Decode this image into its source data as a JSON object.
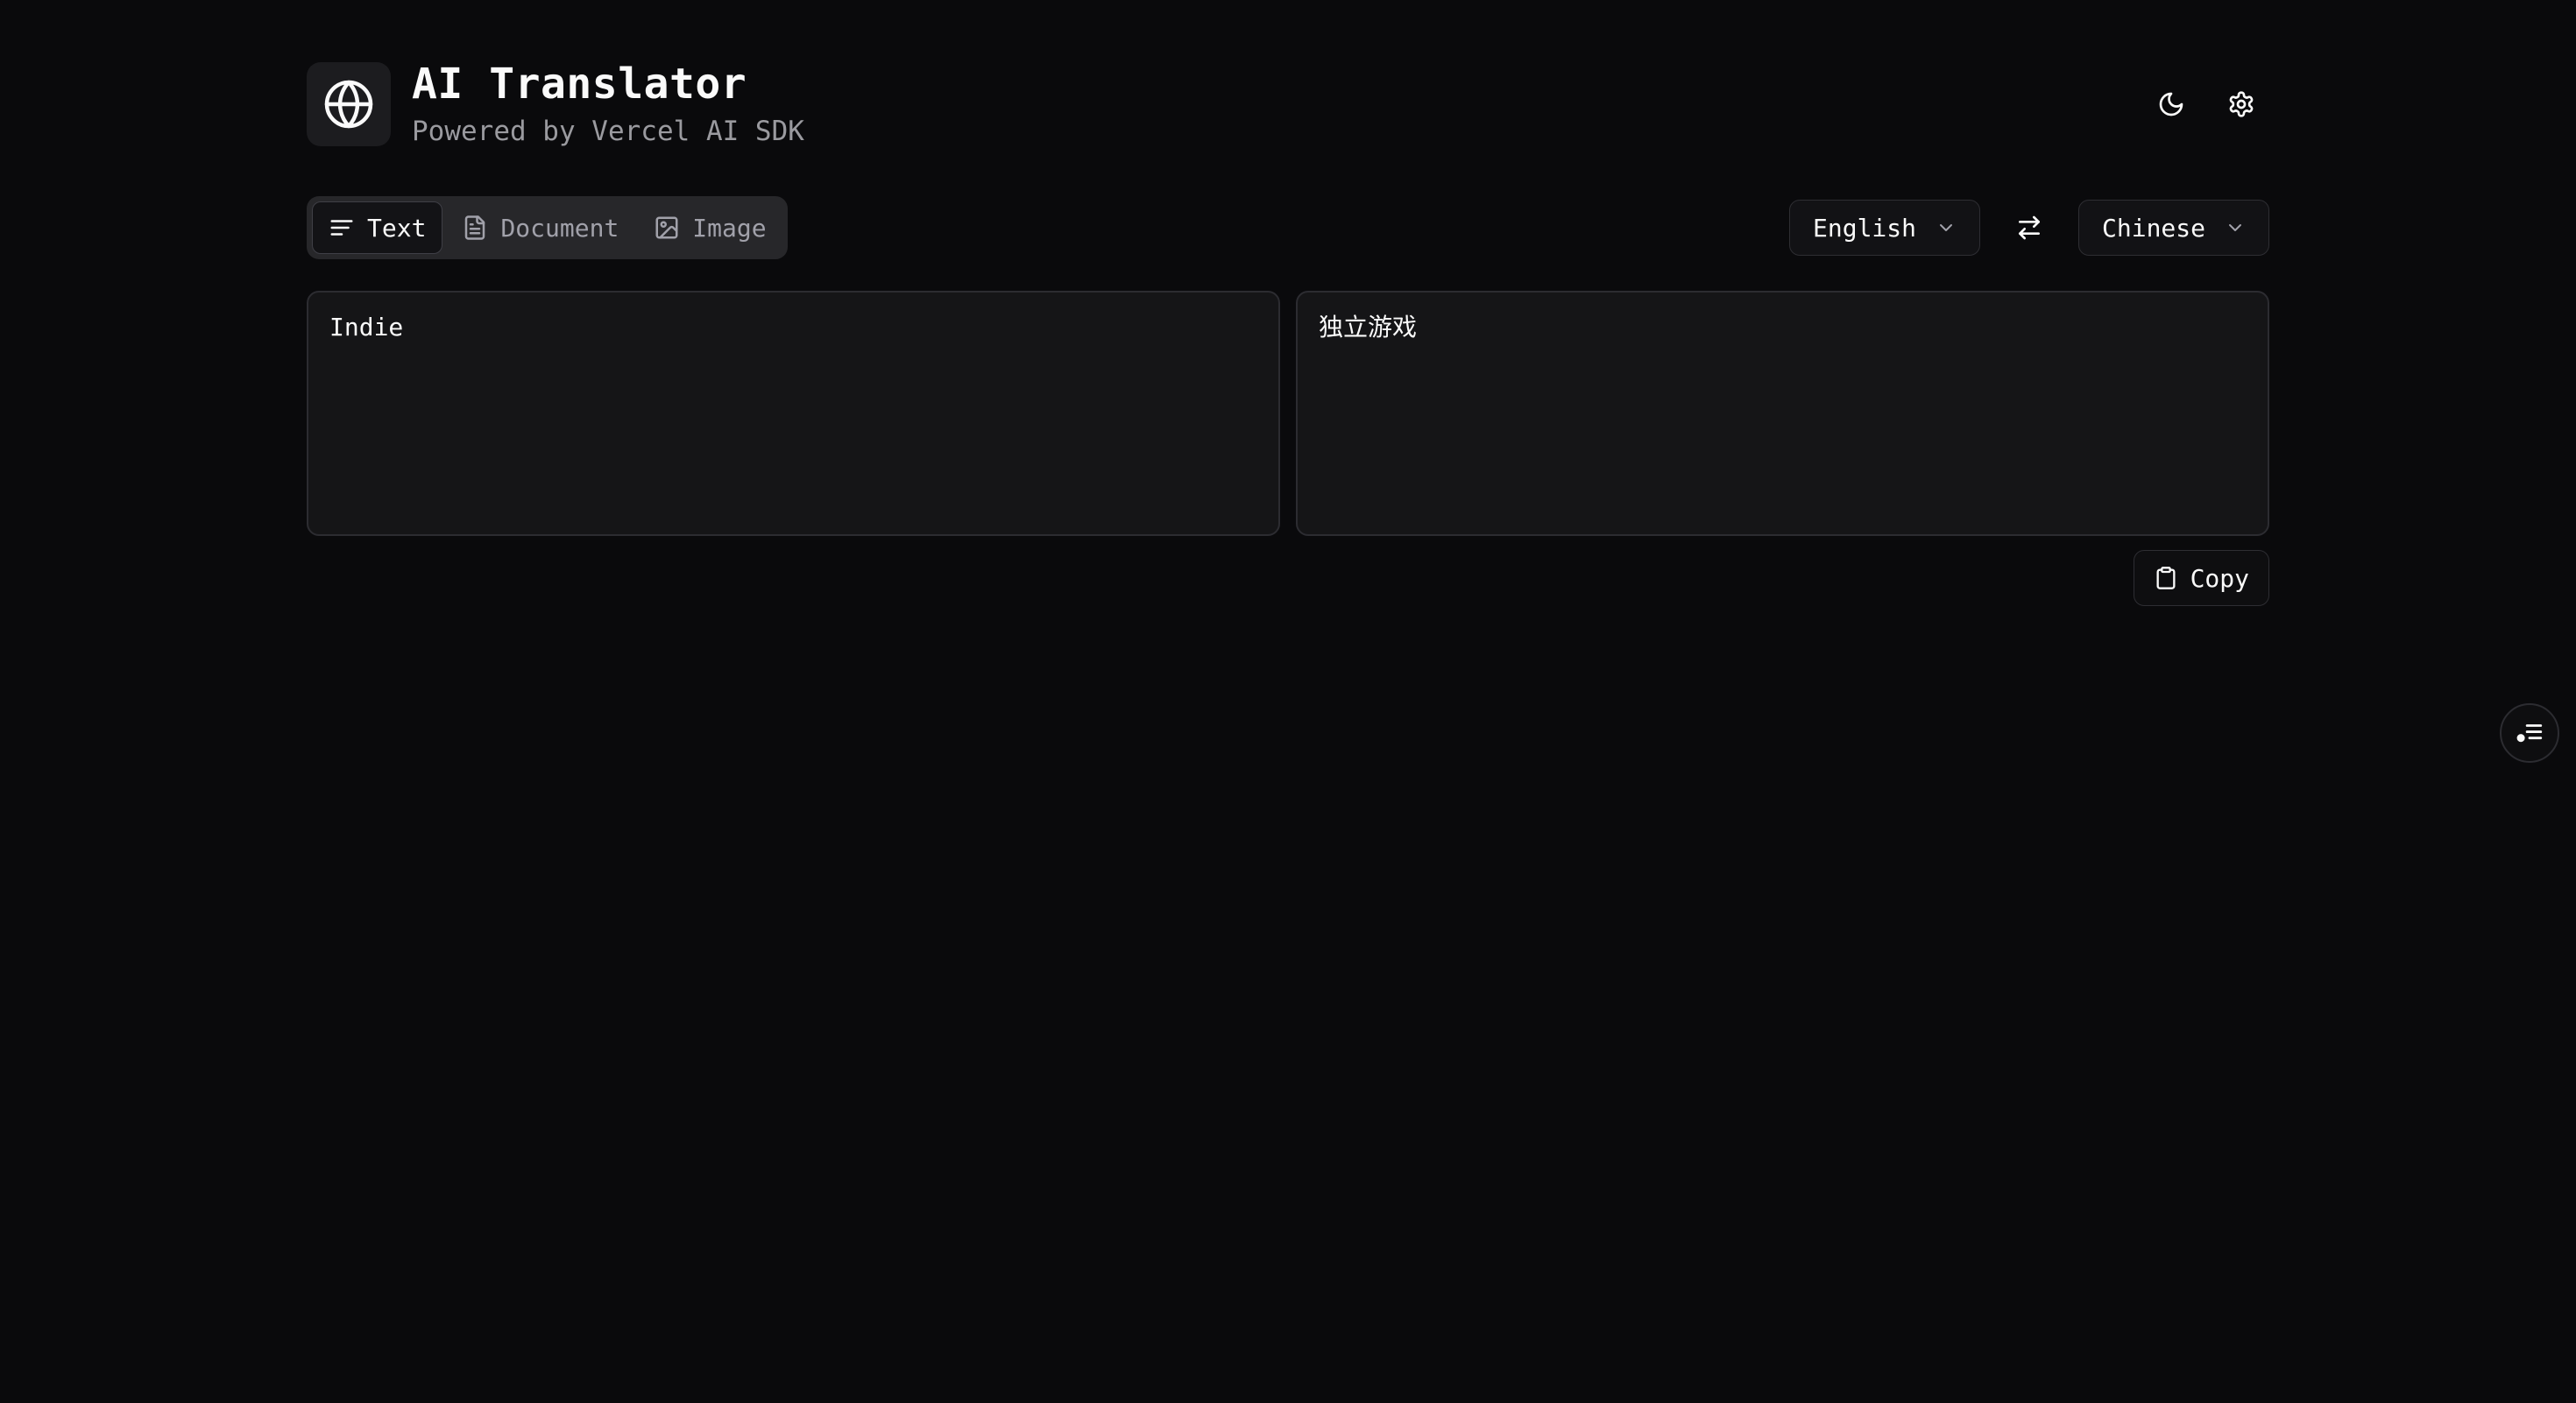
{
  "header": {
    "title": "AI Translator",
    "subtitle": "Powered by Vercel AI SDK",
    "logo_icon": "globe-icon",
    "actions": [
      {
        "name": "theme-toggle",
        "icon": "moon-icon"
      },
      {
        "name": "settings",
        "icon": "gear-icon"
      }
    ]
  },
  "tabs": [
    {
      "label": "Text",
      "icon": "text-lines-icon",
      "active": true
    },
    {
      "label": "Document",
      "icon": "document-icon",
      "active": false
    },
    {
      "label": "Image",
      "icon": "image-icon",
      "active": false
    }
  ],
  "languages": {
    "source": "English",
    "target": "Chinese",
    "swap_icon": "swap-arrows-icon"
  },
  "input": {
    "value": "Indie"
  },
  "output": {
    "value": "独立游戏"
  },
  "copy": {
    "label": "Copy",
    "icon": "clipboard-icon"
  },
  "floating": {
    "icon": "list-settings-icon"
  },
  "colors": {
    "background": "#0a0a0c",
    "surface": "#151517",
    "border": "#2c2c31",
    "text": "#fafafa",
    "muted": "#9a9a9f"
  }
}
